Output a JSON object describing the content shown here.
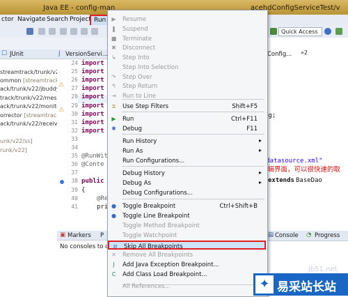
{
  "titlebar": {
    "left": "Java EE - config-man",
    "right": "acehdConfigServiceTest/v"
  },
  "menubar": {
    "items": [
      "ctor",
      "Navigate",
      "Search",
      "Project",
      "Run"
    ]
  },
  "toolbar": {
    "quick_access": "Quick Access"
  },
  "left_panel": {
    "tab": "JUnit",
    "rows": [
      {
        "a": "streamtrack/trunk/v22/",
        "b": ""
      },
      {
        "a": "ommon",
        "b": " [streamtrack/"
      },
      {
        "a": "ack/trunk/v22/jbuddy]",
        "b": ""
      },
      {
        "a": "track/trunk/v22/messa",
        "b": ""
      },
      {
        "a": "ack/trunk/v22/monito",
        "b": ""
      },
      {
        "a": "orrector",
        "b": " [streamtrack/"
      },
      {
        "a": "ack/trunk/v22/receive",
        "b": ""
      },
      {
        "a": "unk/v22/ss]",
        "b": ""
      },
      {
        "a": "runk/v22]",
        "b": ""
      }
    ]
  },
  "editor": {
    "tab": "VersionServi...",
    "lines": [
      {
        "n": "24",
        "kw": "import",
        "rest": ""
      },
      {
        "n": "25",
        "kw": "import",
        "rest": ""
      },
      {
        "n": "26",
        "kw": "import",
        "rest": ""
      },
      {
        "n": "27",
        "kw": "import",
        "rest": ""
      },
      {
        "n": "28",
        "kw": "import",
        "rest": ""
      },
      {
        "n": "29",
        "kw": "import",
        "rest": ""
      },
      {
        "n": "30",
        "kw": "import",
        "rest": ""
      },
      {
        "n": "31",
        "kw": "import",
        "rest": ""
      },
      {
        "n": "32",
        "kw": "import",
        "rest": ""
      },
      {
        "n": "33",
        "kw": "",
        "rest": ""
      },
      {
        "n": "34",
        "kw": "",
        "rest": ""
      },
      {
        "n": "35",
        "kw": "",
        "rest": "@RunWit"
      },
      {
        "n": "36",
        "kw": "",
        "rest": "@Conte"
      },
      {
        "n": "37",
        "kw": "",
        "rest": ""
      },
      {
        "n": "38",
        "kw": "public",
        "rest": ""
      },
      {
        "n": "39",
        "kw": "",
        "rest": "{"
      },
      {
        "n": "40",
        "kw": "",
        "rest": "@Re"
      },
      {
        "n": "41",
        "kw": "",
        "rest": "pri"
      }
    ]
  },
  "right_code": {
    "tab1": "Config...",
    "tab2": "»2",
    "line1": "ig;",
    "line2": "cm-datasource.xml\"",
    "line3a": "extends",
    "line3b": " BaseDao"
  },
  "bottom": {
    "tab_markers": "Markers",
    "tab_p": "P",
    "console_text": "No consoles to di",
    "tab_console": "Console",
    "tab_progress": "Progress"
  },
  "run_menu": {
    "items": [
      {
        "label": "Resume",
        "shortcut": "",
        "enabled": false,
        "icon": "resume-icon",
        "glyph": "▶"
      },
      {
        "label": "Suspend",
        "shortcut": "",
        "enabled": false,
        "icon": "suspend-icon",
        "glyph": "❚"
      },
      {
        "label": "Terminate",
        "shortcut": "",
        "enabled": false,
        "icon": "terminate-icon",
        "glyph": "■"
      },
      {
        "label": "Disconnect",
        "shortcut": "",
        "enabled": false,
        "icon": "disconnect-icon",
        "glyph": "✖"
      },
      {
        "label": "Step Into",
        "shortcut": "",
        "enabled": false,
        "icon": "step-into-icon",
        "glyph": "↳"
      },
      {
        "label": "Step Into Selection",
        "shortcut": "",
        "enabled": false,
        "icon": "",
        "glyph": ""
      },
      {
        "label": "Step Over",
        "shortcut": "",
        "enabled": false,
        "icon": "step-over-icon",
        "glyph": "↷"
      },
      {
        "label": "Step Return",
        "shortcut": "",
        "enabled": false,
        "icon": "step-return-icon",
        "glyph": "↰"
      },
      {
        "label": "Run to Line",
        "shortcut": "",
        "enabled": false,
        "icon": "run-to-line-icon",
        "glyph": "⇥"
      },
      {
        "label": "Use Step Filters",
        "shortcut": "Shift+F5",
        "enabled": true,
        "icon": "step-filters-icon",
        "glyph": "⧖"
      },
      {
        "label": "Run",
        "shortcut": "Ctrl+F11",
        "enabled": true,
        "icon": "run-icon",
        "glyph": "▶"
      },
      {
        "label": "Debug",
        "shortcut": "F11",
        "enabled": true,
        "icon": "debug-icon",
        "glyph": "✱"
      },
      {
        "label": "Run History",
        "shortcut": "",
        "enabled": true,
        "icon": "",
        "glyph": "",
        "submenu": true
      },
      {
        "label": "Run As",
        "shortcut": "",
        "enabled": true,
        "icon": "",
        "glyph": "",
        "submenu": true
      },
      {
        "label": "Run Configurations...",
        "shortcut": "",
        "enabled": true,
        "icon": "",
        "glyph": ""
      },
      {
        "label": "Debug History",
        "shortcut": "",
        "enabled": true,
        "icon": "",
        "glyph": "",
        "submenu": true
      },
      {
        "label": "Debug As",
        "shortcut": "",
        "enabled": true,
        "icon": "",
        "glyph": "",
        "submenu": true
      },
      {
        "label": "Debug Configurations...",
        "shortcut": "",
        "enabled": true,
        "icon": "",
        "glyph": ""
      },
      {
        "label": "Toggle Breakpoint",
        "shortcut": "Ctrl+Shift+B",
        "enabled": true,
        "icon": "breakpoint-icon",
        "glyph": "●"
      },
      {
        "label": "Toggle Line Breakpoint",
        "shortcut": "",
        "enabled": true,
        "icon": "line-breakpoint-icon",
        "glyph": "●"
      },
      {
        "label": "Toggle Method Breakpoint",
        "shortcut": "",
        "enabled": false,
        "icon": "",
        "glyph": ""
      },
      {
        "label": "Toggle Watchpoint",
        "shortcut": "",
        "enabled": false,
        "icon": "",
        "glyph": ""
      },
      {
        "label": "Skip All Breakpoints",
        "shortcut": "",
        "enabled": true,
        "icon": "skip-breakpoints-icon",
        "glyph": "⊘",
        "highlight": true
      },
      {
        "label": "Remove All Breakpoints",
        "shortcut": "",
        "enabled": false,
        "icon": "remove-breakpoints-icon",
        "glyph": "✕"
      },
      {
        "label": "Add Java Exception Breakpoint...",
        "shortcut": "",
        "enabled": true,
        "icon": "exception-breakpoint-icon",
        "glyph": "J"
      },
      {
        "label": "Add Class Load Breakpoint...",
        "shortcut": "",
        "enabled": true,
        "icon": "class-load-breakpoint-icon",
        "glyph": "C"
      },
      {
        "label": "All References...",
        "shortcut": "",
        "enabled": false,
        "icon": "",
        "glyph": ""
      }
    ]
  },
  "annotation": {
    "text": "适用于在编辑界面，可以很快速的取消"
  },
  "watermark": {
    "site": "jb51.net",
    "brand": "易采站长站"
  }
}
